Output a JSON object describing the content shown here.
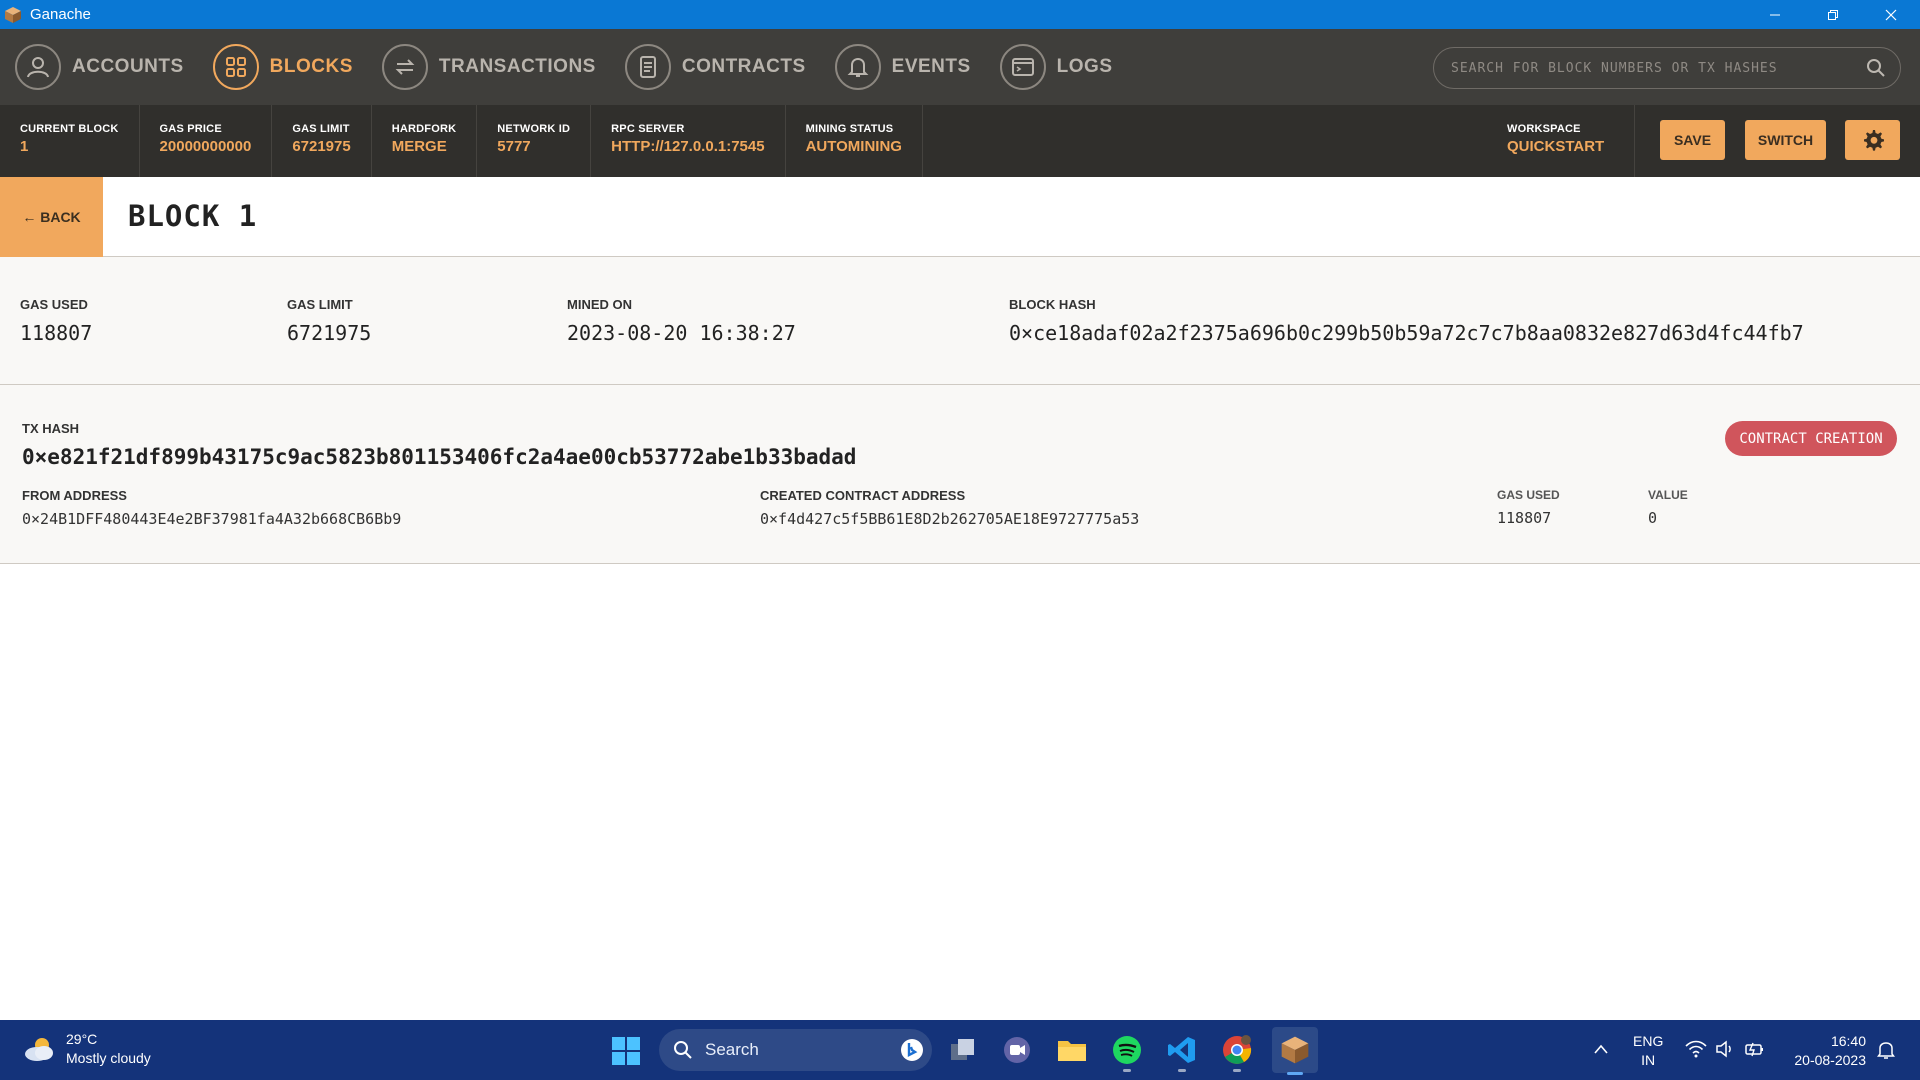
{
  "window": {
    "title": "Ganache"
  },
  "nav": {
    "items": [
      {
        "label": "ACCOUNTS",
        "icon": "account-icon"
      },
      {
        "label": "BLOCKS",
        "icon": "blocks-icon"
      },
      {
        "label": "TRANSACTIONS",
        "icon": "transactions-icon"
      },
      {
        "label": "CONTRACTS",
        "icon": "contracts-icon"
      },
      {
        "label": "EVENTS",
        "icon": "bell-icon"
      },
      {
        "label": "LOGS",
        "icon": "logs-icon"
      }
    ],
    "active": "BLOCKS",
    "search_placeholder": "SEARCH FOR BLOCK NUMBERS OR TX HASHES"
  },
  "stats": {
    "current_block": {
      "label": "CURRENT BLOCK",
      "value": "1"
    },
    "gas_price": {
      "label": "GAS PRICE",
      "value": "20000000000"
    },
    "gas_limit": {
      "label": "GAS LIMIT",
      "value": "6721975"
    },
    "hardfork": {
      "label": "HARDFORK",
      "value": "MERGE"
    },
    "network_id": {
      "label": "NETWORK ID",
      "value": "5777"
    },
    "rpc_server": {
      "label": "RPC SERVER",
      "value": "HTTP://127.0.0.1:7545"
    },
    "mining_status": {
      "label": "MINING STATUS",
      "value": "AUTOMINING"
    },
    "workspace": {
      "label": "WORKSPACE",
      "value": "QUICKSTART"
    },
    "save_label": "SAVE",
    "switch_label": "SWITCH"
  },
  "block": {
    "back_label": "← BACK",
    "title": "BLOCK 1",
    "gas_used": {
      "label": "GAS USED",
      "value": "118807"
    },
    "gas_limit": {
      "label": "GAS LIMIT",
      "value": "6721975"
    },
    "mined_on": {
      "label": "MINED ON",
      "value": "2023-08-20 16:38:27"
    },
    "block_hash": {
      "label": "BLOCK HASH",
      "value": "0×ce18adaf02a2f2375a696b0c299b50b59a72c7c7b8aa0832e827d63d4fc44fb7"
    }
  },
  "transaction": {
    "tx_hash_label": "TX HASH",
    "tx_hash": "0×e821f21df899b43175c9ac5823b801153406fc2a4ae00cb53772abe1b33badad",
    "type_badge": "CONTRACT CREATION",
    "from_label": "FROM ADDRESS",
    "from": "0×24B1DFF480443E4e2BF37981fa4A32b668CB6Bb9",
    "created_label": "CREATED CONTRACT ADDRESS",
    "created": "0×f4d427c5f5BB61E8D2b262705AE18E9727775a53",
    "gas_used_label": "GAS USED",
    "gas_used": "118807",
    "value_label": "VALUE",
    "value": "0"
  },
  "taskbar": {
    "weather_temp": "29°C",
    "weather_desc": "Mostly cloudy",
    "search_label": "Search",
    "lang_top": "ENG",
    "lang_bottom": "IN",
    "time": "16:40",
    "date": "20-08-2023"
  },
  "colors": {
    "accent": "#f1a85d",
    "nav_bg": "#3f3e3b",
    "stats_bg": "#302f2c",
    "badge": "#d0555c",
    "titlebar": "#0a78d4",
    "taskbar": "#14337a"
  }
}
